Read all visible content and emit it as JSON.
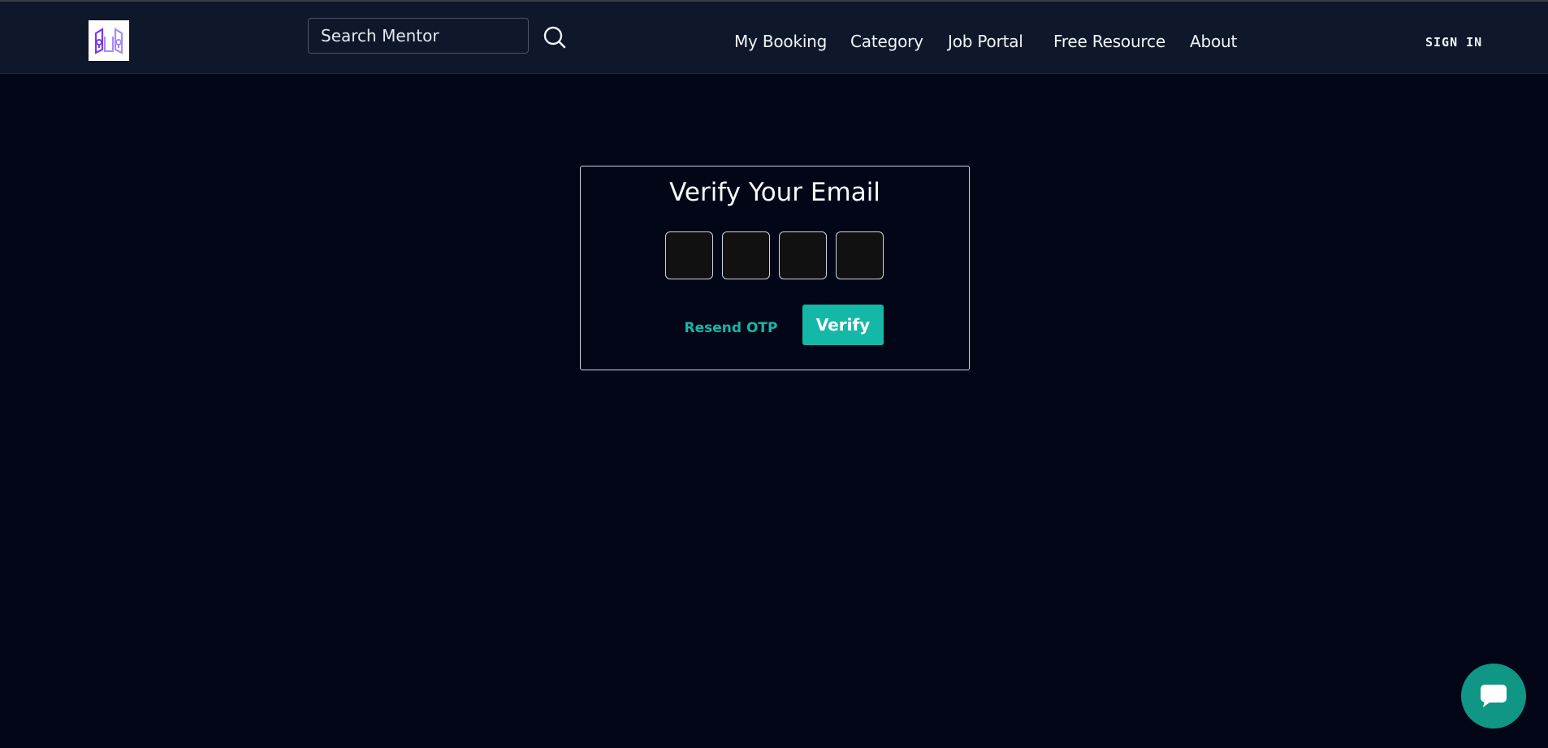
{
  "header": {
    "logo_name": "mentor-logo",
    "search": {
      "placeholder": "Search Mentor",
      "value": ""
    },
    "search_icon": "search-icon",
    "nav": [
      {
        "label": "My Booking"
      },
      {
        "label": "Category"
      },
      {
        "label": "Job Portal"
      },
      {
        "label": "Free Resource"
      },
      {
        "label": "About"
      }
    ],
    "signin_label": "SIGN IN"
  },
  "verify_card": {
    "title": "Verify Your Email",
    "otp_digits": [
      "",
      "",
      "",
      ""
    ],
    "resend_label": "Resend OTP",
    "verify_label": "Verify"
  },
  "chat": {
    "icon": "chat-bubble-icon"
  },
  "colors": {
    "background": "#020617",
    "header_bg": "#0f172a",
    "accent": "#14b8a6",
    "chat_button": "#0f9684",
    "logo_purple": "#7c3aed"
  }
}
